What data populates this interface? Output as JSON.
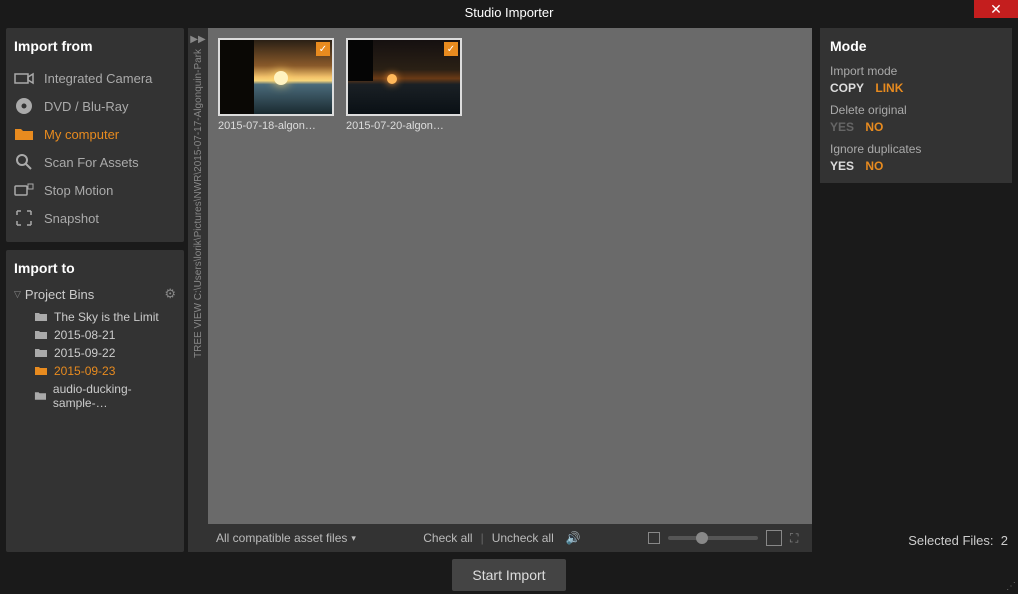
{
  "window": {
    "title": "Studio Importer"
  },
  "importFrom": {
    "title": "Import from",
    "items": [
      {
        "label": "Integrated Camera",
        "icon": "camera"
      },
      {
        "label": "DVD / Blu-Ray",
        "icon": "disc"
      },
      {
        "label": "My computer",
        "icon": "folder",
        "active": true
      },
      {
        "label": "Scan For Assets",
        "icon": "search"
      },
      {
        "label": "Stop Motion",
        "icon": "stopmotion"
      },
      {
        "label": "Snapshot",
        "icon": "snapshot"
      }
    ]
  },
  "importTo": {
    "title": "Import to",
    "root": "Project Bins",
    "bins": [
      {
        "label": "The Sky is the Limit"
      },
      {
        "label": "2015-08-21"
      },
      {
        "label": "2015-09-22"
      },
      {
        "label": "2015-09-23",
        "active": true
      },
      {
        "label": "audio-ducking-sample-…"
      }
    ]
  },
  "treeRail": "TREE VIEW C:\\Users\\lorik\\Pictures\\NWR\\2015-07-17-Algonquin-Park",
  "thumbs": [
    {
      "label": "2015-07-18-algon…",
      "checked": true
    },
    {
      "label": "2015-07-20-algon…",
      "checked": true
    }
  ],
  "bottom": {
    "filter": "All compatible asset files",
    "checkAll": "Check all",
    "uncheckAll": "Uncheck all"
  },
  "mode": {
    "title": "Mode",
    "importMode": {
      "label": "Import mode",
      "selected": "COPY",
      "other": "LINK"
    },
    "deleteOriginal": {
      "label": "Delete original",
      "disabled": "YES",
      "selected": "NO"
    },
    "ignoreDuplicates": {
      "label": "Ignore duplicates",
      "selected": "YES",
      "other": "NO"
    }
  },
  "status": {
    "selectedLabel": "Selected Files:",
    "selectedCount": "2"
  },
  "actions": {
    "start": "Start Import"
  }
}
